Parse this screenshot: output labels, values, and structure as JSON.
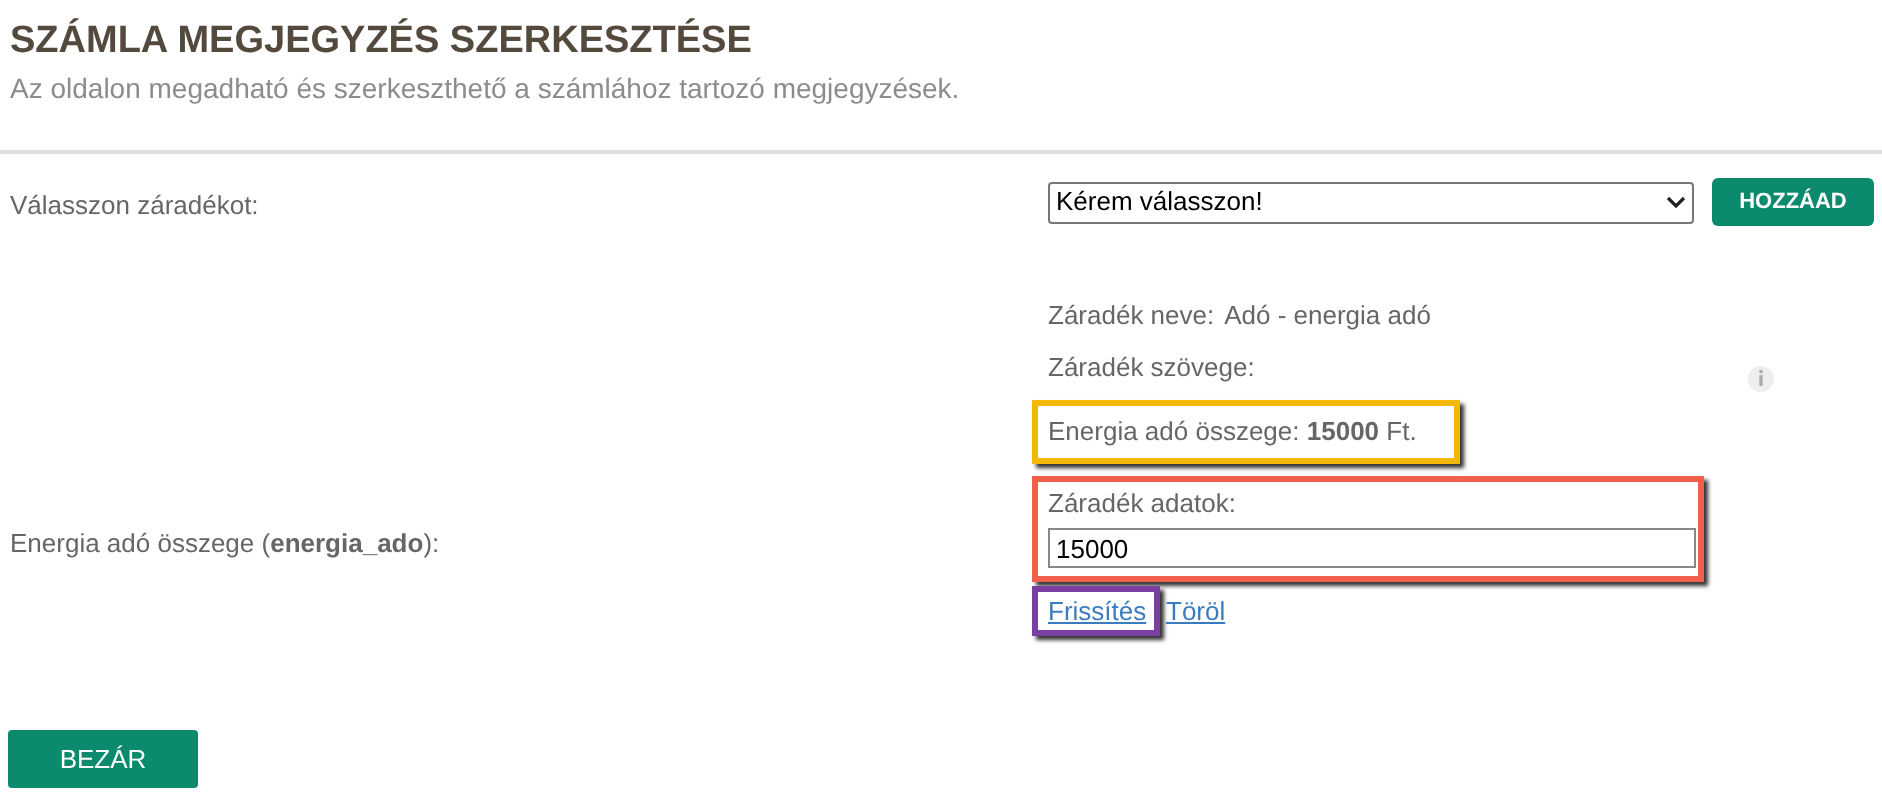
{
  "header": {
    "title": "SZÁMLA MEGJEGYZÉS SZERKESZTÉSE",
    "subtitle": "Az oldalon megadható és szerkeszthető a számlához tartozó megjegyzések."
  },
  "clause_select": {
    "label": "Válasszon záradékot:",
    "value": "Kérem válasszon!",
    "add_button": "HOZZÁAD"
  },
  "clause": {
    "name_label": "Záradék neve:",
    "name": "Adó - energia adó",
    "text_label": "Záradék szövege:",
    "preview": "Energia adó összege: **15000** Ft."
  },
  "field": {
    "label": "Energia adó összege (**energia_ado**):",
    "data_label": "Záradék adatok:",
    "value": "15000"
  },
  "links": [
    "Frissítés",
    "Töröl"
  ],
  "close_button": "BEZÁR"
}
